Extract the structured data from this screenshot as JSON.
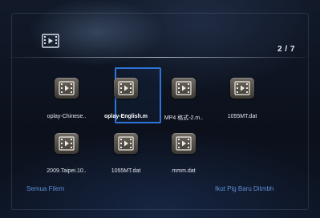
{
  "header": {
    "icon": "video-folder-icon",
    "page_count": "2 / 7"
  },
  "files": [
    {
      "label": "oplay-Chinese..",
      "icon": "video-file-icon",
      "selected": false
    },
    {
      "label": "oplay-English.m",
      "icon": "video-file-icon",
      "selected": true
    },
    {
      "label": "MP4 格式-2.m..",
      "icon": "video-file-icon",
      "selected": false
    },
    {
      "label": "1055MT.dat",
      "icon": "video-file-icon",
      "selected": false
    },
    {
      "label": "2009.Taipei.10..",
      "icon": "video-file-icon",
      "selected": false
    },
    {
      "label": "1055MT.dat",
      "icon": "video-file-icon",
      "selected": false
    },
    {
      "label": "mmm.dat",
      "icon": "video-file-icon",
      "selected": false
    }
  ],
  "footer": {
    "left_label": "Semua Filem",
    "right_label": "Ikut Plg Baru Ditmbh"
  },
  "colors": {
    "focus": "#2e74d8",
    "footer_text": "#5f8fd6"
  }
}
